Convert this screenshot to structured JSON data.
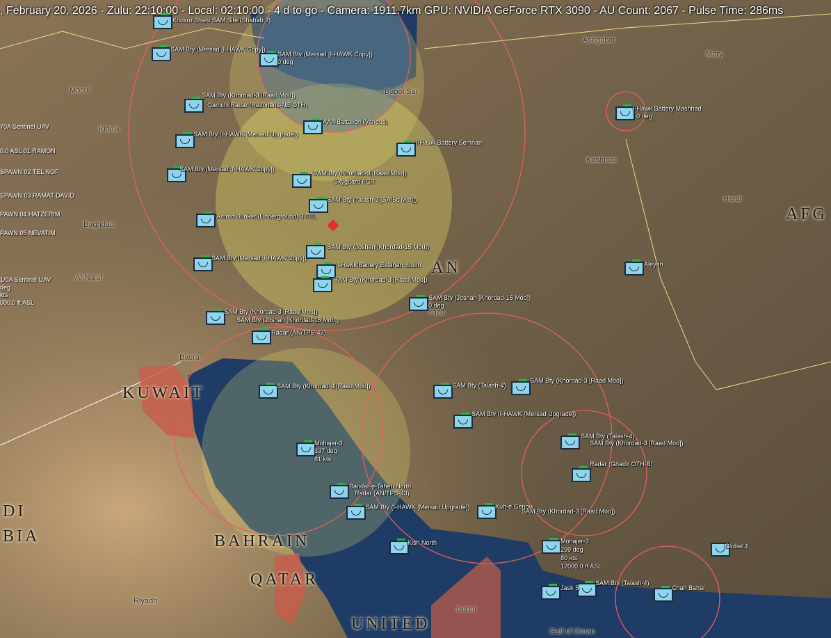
{
  "hud": {
    "date": ", February 20, 2026",
    "zulu": "Zulu: 22:10:00",
    "local": "Local: 02:10:00",
    "togo": "4 d to go",
    "camera": "Camera: 1911.7km",
    "gpu": "GPU: NVIDIA GeForce RTX 3090",
    "au": "AU Count: 2067",
    "pulse": "Pulse Time: 286ms"
  },
  "side_labels": [
    "70A Sentinel UAV",
    "0.0 ASL 01 RAMON",
    "SPAWN 02 TEL NOF",
    "SPAWN 03 RAMAT DAVID",
    "PAWN 04 HATZERIM",
    "PAWN 05 NEVATIM",
    "1/0A Sentinel UAV",
    "deg",
    "kts",
    "000.0 ft ASL"
  ],
  "countries": {
    "kuwait": "KUWAIT",
    "bahrain": "BAHRAIN",
    "qatar": "QATAR",
    "united": "UNITED",
    "di": "DI",
    "bia": "BIA",
    "an": "AN",
    "afg": "AFG"
  },
  "cities": {
    "mosul": "Mosul",
    "kirkuk": "Kirkuk",
    "baghdad": "Baghdad",
    "najaf": "Al-Najaf",
    "basra": "Basra",
    "riyadh": "Riyadh",
    "dubai": "Dubai",
    "ashgabat": "Ashgabat",
    "mary": "Mary",
    "herat": "Herat",
    "kashmar": "Kashmar",
    "babolsar": "Babol Sar",
    "yazd": "Yazd",
    "gulf": "Gulf of Oman"
  },
  "units": [
    {
      "label": "Khosro Shahi SAM Site (Shahab 3)"
    },
    {
      "label": "SAM Bty (Mersad [I-HAWK Copy])"
    },
    {
      "label": "SAM Bty (Mersad [I-HAWK Copy])",
      "sub": "0 deg"
    },
    {
      "label": "SAM Bty (Khordad-3 [Raad Mod])"
    },
    {
      "label": "Qamchi Radar (Rezonans-NE OTH)"
    },
    {
      "label": "SAM Bty (I-HAWK [Mersad Upgrade])"
    },
    {
      "label": "AAA Battalion (Various)"
    },
    {
      "label": "I-Hawk Battery Semnan"
    },
    {
      "label": "I-Hawk Battery Mashhad",
      "sub": "0 deg"
    },
    {
      "label": "SAM Bty (Mersad [I-HAWK Copy])"
    },
    {
      "label": "SAM Bty (Khordad-3 [Raad Mod])"
    },
    {
      "label": "Skyguard FCR"
    },
    {
      "label": "SAM Bty (Talash-3 [SA-5c Mod])"
    },
    {
      "label": "Ammo Bunker (Underground) 3 TEL"
    },
    {
      "label": "SAM Bty (Joshan [Khordad-15 Mod])"
    },
    {
      "label": "SAM Bty (Mersad [I-HAWK Copy])"
    },
    {
      "label": "I-Hawk Battery Esfahan South"
    },
    {
      "label": "SAM Bty (Khordad-3 [Raad Mod])"
    },
    {
      "label": "SAM Bty (Joshan [Khordad-15 Mod])",
      "sub": "0 deg"
    },
    {
      "label": "Aleyan"
    },
    {
      "label": "SAM Bty (Khordad-3 [Raad Mod])"
    },
    {
      "label": "SAM Bty (Joshan [Khordad-15 Mod])"
    },
    {
      "label": "Radar (AN/TPS-43)"
    },
    {
      "label": "SAM Bty (Khordad-3 [Raad Mod])"
    },
    {
      "label": "SAM Bty (Talash-4)"
    },
    {
      "label": "SAM Bty (Khordad-3 [Raad Mod])"
    },
    {
      "label": "SAM Bty (I-HAWK [Mersad Upgrade])"
    },
    {
      "label": "SAM Bty (Talash-4)"
    },
    {
      "label": "SAM Bty (Khordad-3 [Raad Mod])"
    },
    {
      "label": "Radar (Ghadir OTH-B)"
    },
    {
      "label": "Mohajer-3",
      "sub": "337 deg"
    },
    {
      "label": "Bandar-e-Taheri North"
    },
    {
      "label": "Radar (AN/TPS-43)"
    },
    {
      "label": "SAM Bty (I-HAWK [Mersad Upgrade])"
    },
    {
      "label": "Kuh-e Genow"
    },
    {
      "label": "SAM Bty (Khordad-3 [Raad Mod])"
    },
    {
      "label": "Mohajer-3",
      "sub": "299 deg"
    },
    {
      "label": "Global 4"
    },
    {
      "label": "SAM Bty (Talash-4)"
    },
    {
      "label": "Chah Bahar"
    },
    {
      "label": "Jask S"
    },
    {
      "label": "Kish North"
    }
  ],
  "mohajer_extra": {
    "speed": "80 kts",
    "alt": "12000.0 ft ASL",
    "speed2": "81 kts"
  },
  "colors": {
    "accent_green": "#2cb24a",
    "unit_fill": "#8fd4ee",
    "range_ring": "#e66060",
    "yellow_zone": "#e8e06a",
    "sea": "#1e3c66"
  }
}
